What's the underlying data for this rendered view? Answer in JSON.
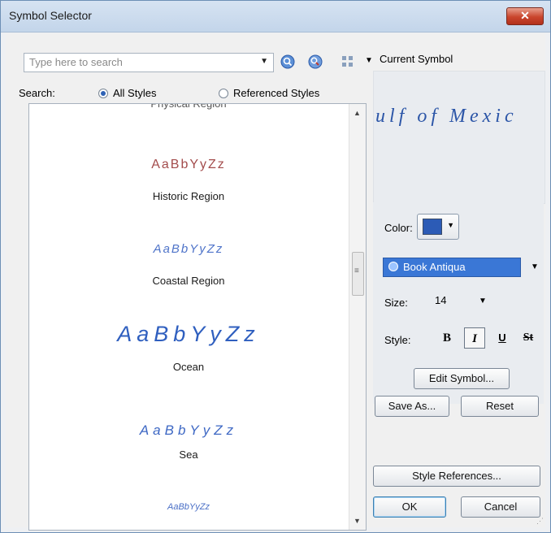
{
  "window": {
    "title": "Symbol Selector",
    "close_glyph": "✕"
  },
  "search": {
    "placeholder": "Type here to search",
    "label": "Search:"
  },
  "radios": [
    {
      "label": "All Styles",
      "checked": true
    },
    {
      "label": "Referenced Styles",
      "checked": false
    }
  ],
  "symbols": [
    {
      "name": "Physical Region",
      "sample": ""
    },
    {
      "name": "Historic Region",
      "sample": "AaBbYyZz",
      "color": "#a34c4c"
    },
    {
      "name": "Coastal Region",
      "sample": "AaBbYyZz",
      "color": "#4f74c9"
    },
    {
      "name": "Ocean",
      "sample": "AaBbYyZz",
      "color": "#2f5fbf"
    },
    {
      "name": "Sea",
      "sample": "AaBbYyZz",
      "color": "#3e68c4"
    },
    {
      "name": "",
      "sample": "AaBbYyZz",
      "color": "#4a6fc6"
    }
  ],
  "current_symbol": {
    "label": "Current Symbol",
    "preview_text": "ulf of Mexic",
    "color": "#2b55a7"
  },
  "properties": {
    "color_label": "Color:",
    "color_value": "#2c5bb6",
    "font": "Book Antiqua",
    "size_label": "Size:",
    "size": "14",
    "style_label": "Style:",
    "style_buttons": [
      "B",
      "I",
      "U",
      "St"
    ],
    "italic_active": true
  },
  "buttons": {
    "edit_symbol": "Edit Symbol...",
    "save_as": "Save As...",
    "reset": "Reset",
    "style_references": "Style References...",
    "ok": "OK",
    "cancel": "Cancel"
  },
  "icons": {
    "search_glyph": "🔍",
    "zoom_glyph": "🔎",
    "view_glyph": "▦",
    "caret": "▼",
    "scroll_up": "▲",
    "scroll_down": "▼"
  }
}
